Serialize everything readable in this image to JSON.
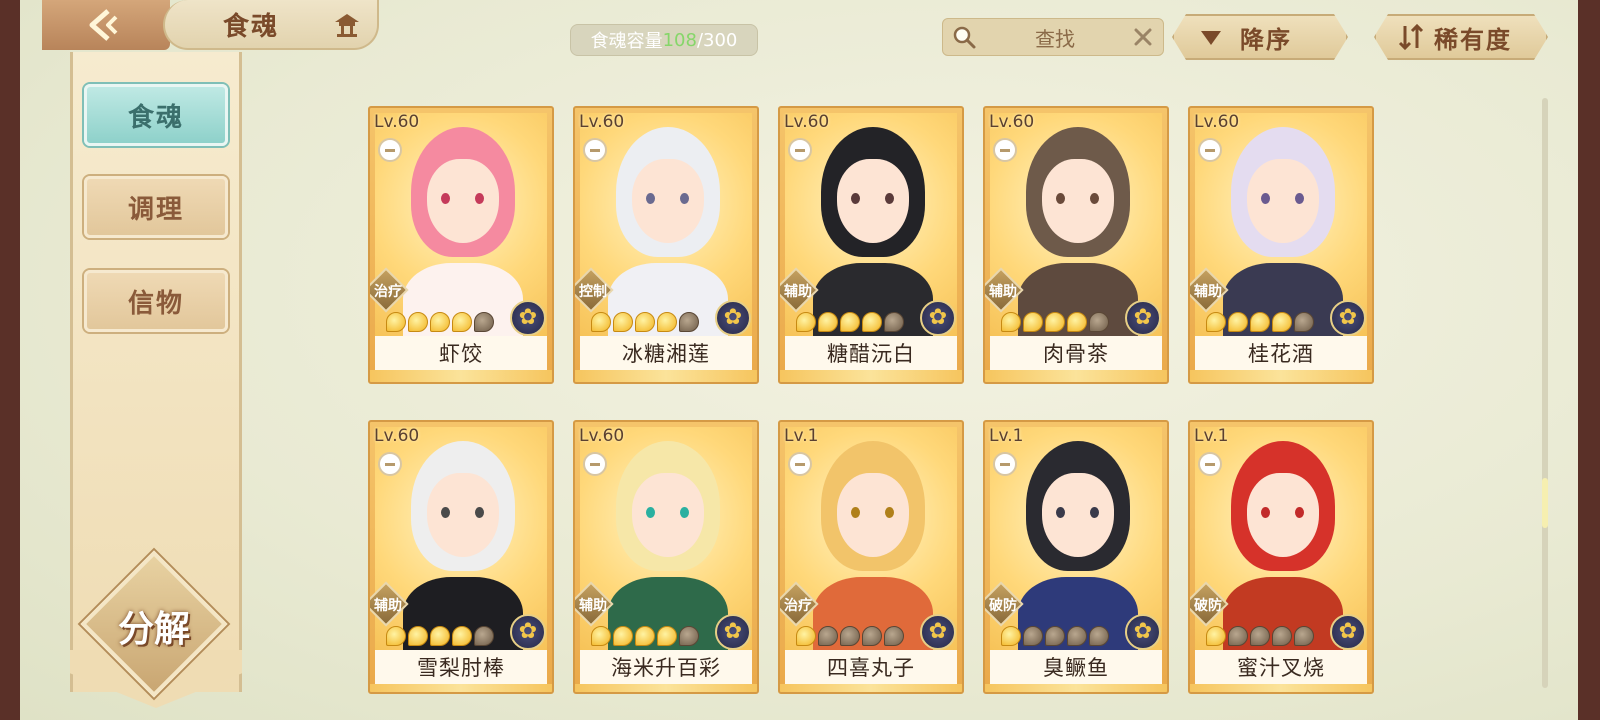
{
  "header": {
    "title": "食魂",
    "capacity_label": "食魂容量",
    "capacity_current": "108",
    "capacity_sep": "/",
    "capacity_max": "300",
    "search_label": "查找",
    "sort_order_label": "降序",
    "sort_field_label": "稀有度"
  },
  "sidebar": {
    "items": [
      {
        "label": "食魂",
        "active": true
      },
      {
        "label": "调理",
        "active": false
      },
      {
        "label": "信物",
        "active": false
      }
    ],
    "decompose_label": "分解"
  },
  "cards": [
    {
      "level": "Lv.60",
      "role": "治疗",
      "name": "虾饺",
      "stars_on": 4,
      "stars_total": 5,
      "hair": "#f58aa0",
      "body": "#fdf2ee",
      "eye": "#c53a5a"
    },
    {
      "level": "Lv.60",
      "role": "控制",
      "name": "冰糖湘莲",
      "stars_on": 4,
      "stars_total": 5,
      "hair": "#eceef2",
      "body": "#f0f0f4",
      "eye": "#6a6a90"
    },
    {
      "level": "Lv.60",
      "role": "辅助",
      "name": "糖醋沅白",
      "stars_on": 4,
      "stars_total": 5,
      "hair": "#232327",
      "body": "#2a2a2e",
      "eye": "#5a3a3a"
    },
    {
      "level": "Lv.60",
      "role": "辅助",
      "name": "肉骨茶",
      "stars_on": 4,
      "stars_total": 5,
      "hair": "#6e5a4a",
      "body": "#5e4a3e",
      "eye": "#6a4a3a"
    },
    {
      "level": "Lv.60",
      "role": "辅助",
      "name": "桂花酒",
      "stars_on": 4,
      "stars_total": 5,
      "hair": "#e4dcf0",
      "body": "#3a3a52",
      "eye": "#6a5a90"
    },
    {
      "level": "Lv.60",
      "role": "辅助",
      "name": "雪梨肘棒",
      "stars_on": 4,
      "stars_total": 5,
      "hair": "#eeeeee",
      "body": "#1e1e22",
      "eye": "#4a4a4a"
    },
    {
      "level": "Lv.60",
      "role": "辅助",
      "name": "海米升百彩",
      "stars_on": 4,
      "stars_total": 5,
      "hair": "#f6e7a8",
      "body": "#2e6a4a",
      "eye": "#2ab0a0"
    },
    {
      "level": "Lv.1",
      "role": "治疗",
      "name": "四喜丸子",
      "stars_on": 1,
      "stars_total": 5,
      "hair": "#f2c46a",
      "body": "#e06a3a",
      "eye": "#b0801a"
    },
    {
      "level": "Lv.1",
      "role": "破防",
      "name": "臭鳜鱼",
      "stars_on": 1,
      "stars_total": 5,
      "hair": "#2a2a30",
      "body": "#2e3a7a",
      "eye": "#3a3a4a"
    },
    {
      "level": "Lv.1",
      "role": "破防",
      "name": "蜜汁叉烧",
      "stars_on": 1,
      "stars_total": 5,
      "hair": "#d6322a",
      "body": "#c23a22",
      "eye": "#c22a2a"
    }
  ]
}
